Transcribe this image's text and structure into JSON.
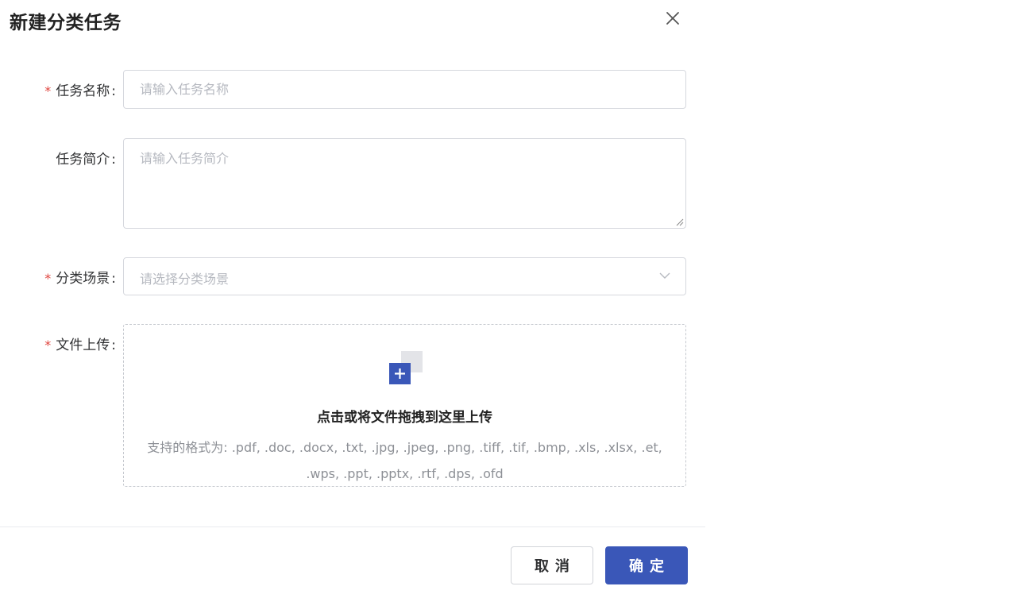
{
  "dialog": {
    "title": "新建分类任务",
    "close_icon": "close-icon"
  },
  "form": {
    "task_name": {
      "required": true,
      "label": "任务名称",
      "placeholder": "请输入任务名称",
      "value": ""
    },
    "task_desc": {
      "required": false,
      "label": "任务简介",
      "placeholder": "请输入任务简介",
      "value": ""
    },
    "scene": {
      "required": true,
      "label": "分类场景",
      "placeholder": "请选择分类场景",
      "icon": "chevron-down-icon"
    },
    "upload": {
      "required": true,
      "label": "文件上传",
      "icon": "upload-add-icon",
      "main_text": "点击或将文件拖拽到这里上传",
      "sub_text": "支持的格式为: .pdf, .doc, .docx, .txt, .jpg, .jpeg, .png, .tiff, .tif, .bmp, .xls, .xlsx, .et, .wps, .ppt, .pptx, .rtf, .dps, .ofd"
    }
  },
  "footer": {
    "cancel_label": "取消",
    "ok_label": "确定"
  },
  "colors": {
    "primary": "#3a57b8",
    "required_star": "#e0443e",
    "border": "#d6d8de",
    "placeholder": "#b6b9c0"
  }
}
